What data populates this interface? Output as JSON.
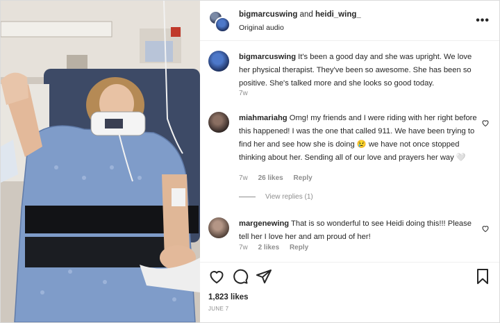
{
  "header": {
    "user1": "bigmarcuswing",
    "conjunction": "and",
    "user2": "heidi_wing_",
    "audio": "Original audio",
    "more_icon": "more-options-icon"
  },
  "comments": [
    {
      "username": "bigmarcuswing",
      "text": "It's been a good day and she was upright. We love her physical therapist. They've been so awesome. She has been so positive. She's talked more and she looks so good today.",
      "time": "7w",
      "likes": "",
      "reply": "",
      "avatar_color": "#2b4fa8"
    },
    {
      "username": "miahmariahg",
      "text": "Omg! my friends and I were riding with her right before this happened! I was the one that called 911. We have been trying to find her and see how she is doing 😢 we have not once stopped thinking about her. Sending all of our love and prayers her way 🤍",
      "time": "7w",
      "likes": "26 likes",
      "reply": "Reply",
      "avatar_color": "#3a2d2a"
    },
    {
      "username": "margenewing",
      "text": "That is so wonderful to see Heidi doing this!!! Please tell her I love her and am proud of her!",
      "time": "7w",
      "likes": "2 likes",
      "reply": "Reply",
      "avatar_color": "#6b5448"
    }
  ],
  "view_replies": "View replies (1)",
  "actions": {
    "like_icon": "heart-icon",
    "comment_icon": "comment-icon",
    "share_icon": "share-icon",
    "save_icon": "bookmark-icon"
  },
  "likes": "1,823 likes",
  "date": "JUNE 7"
}
